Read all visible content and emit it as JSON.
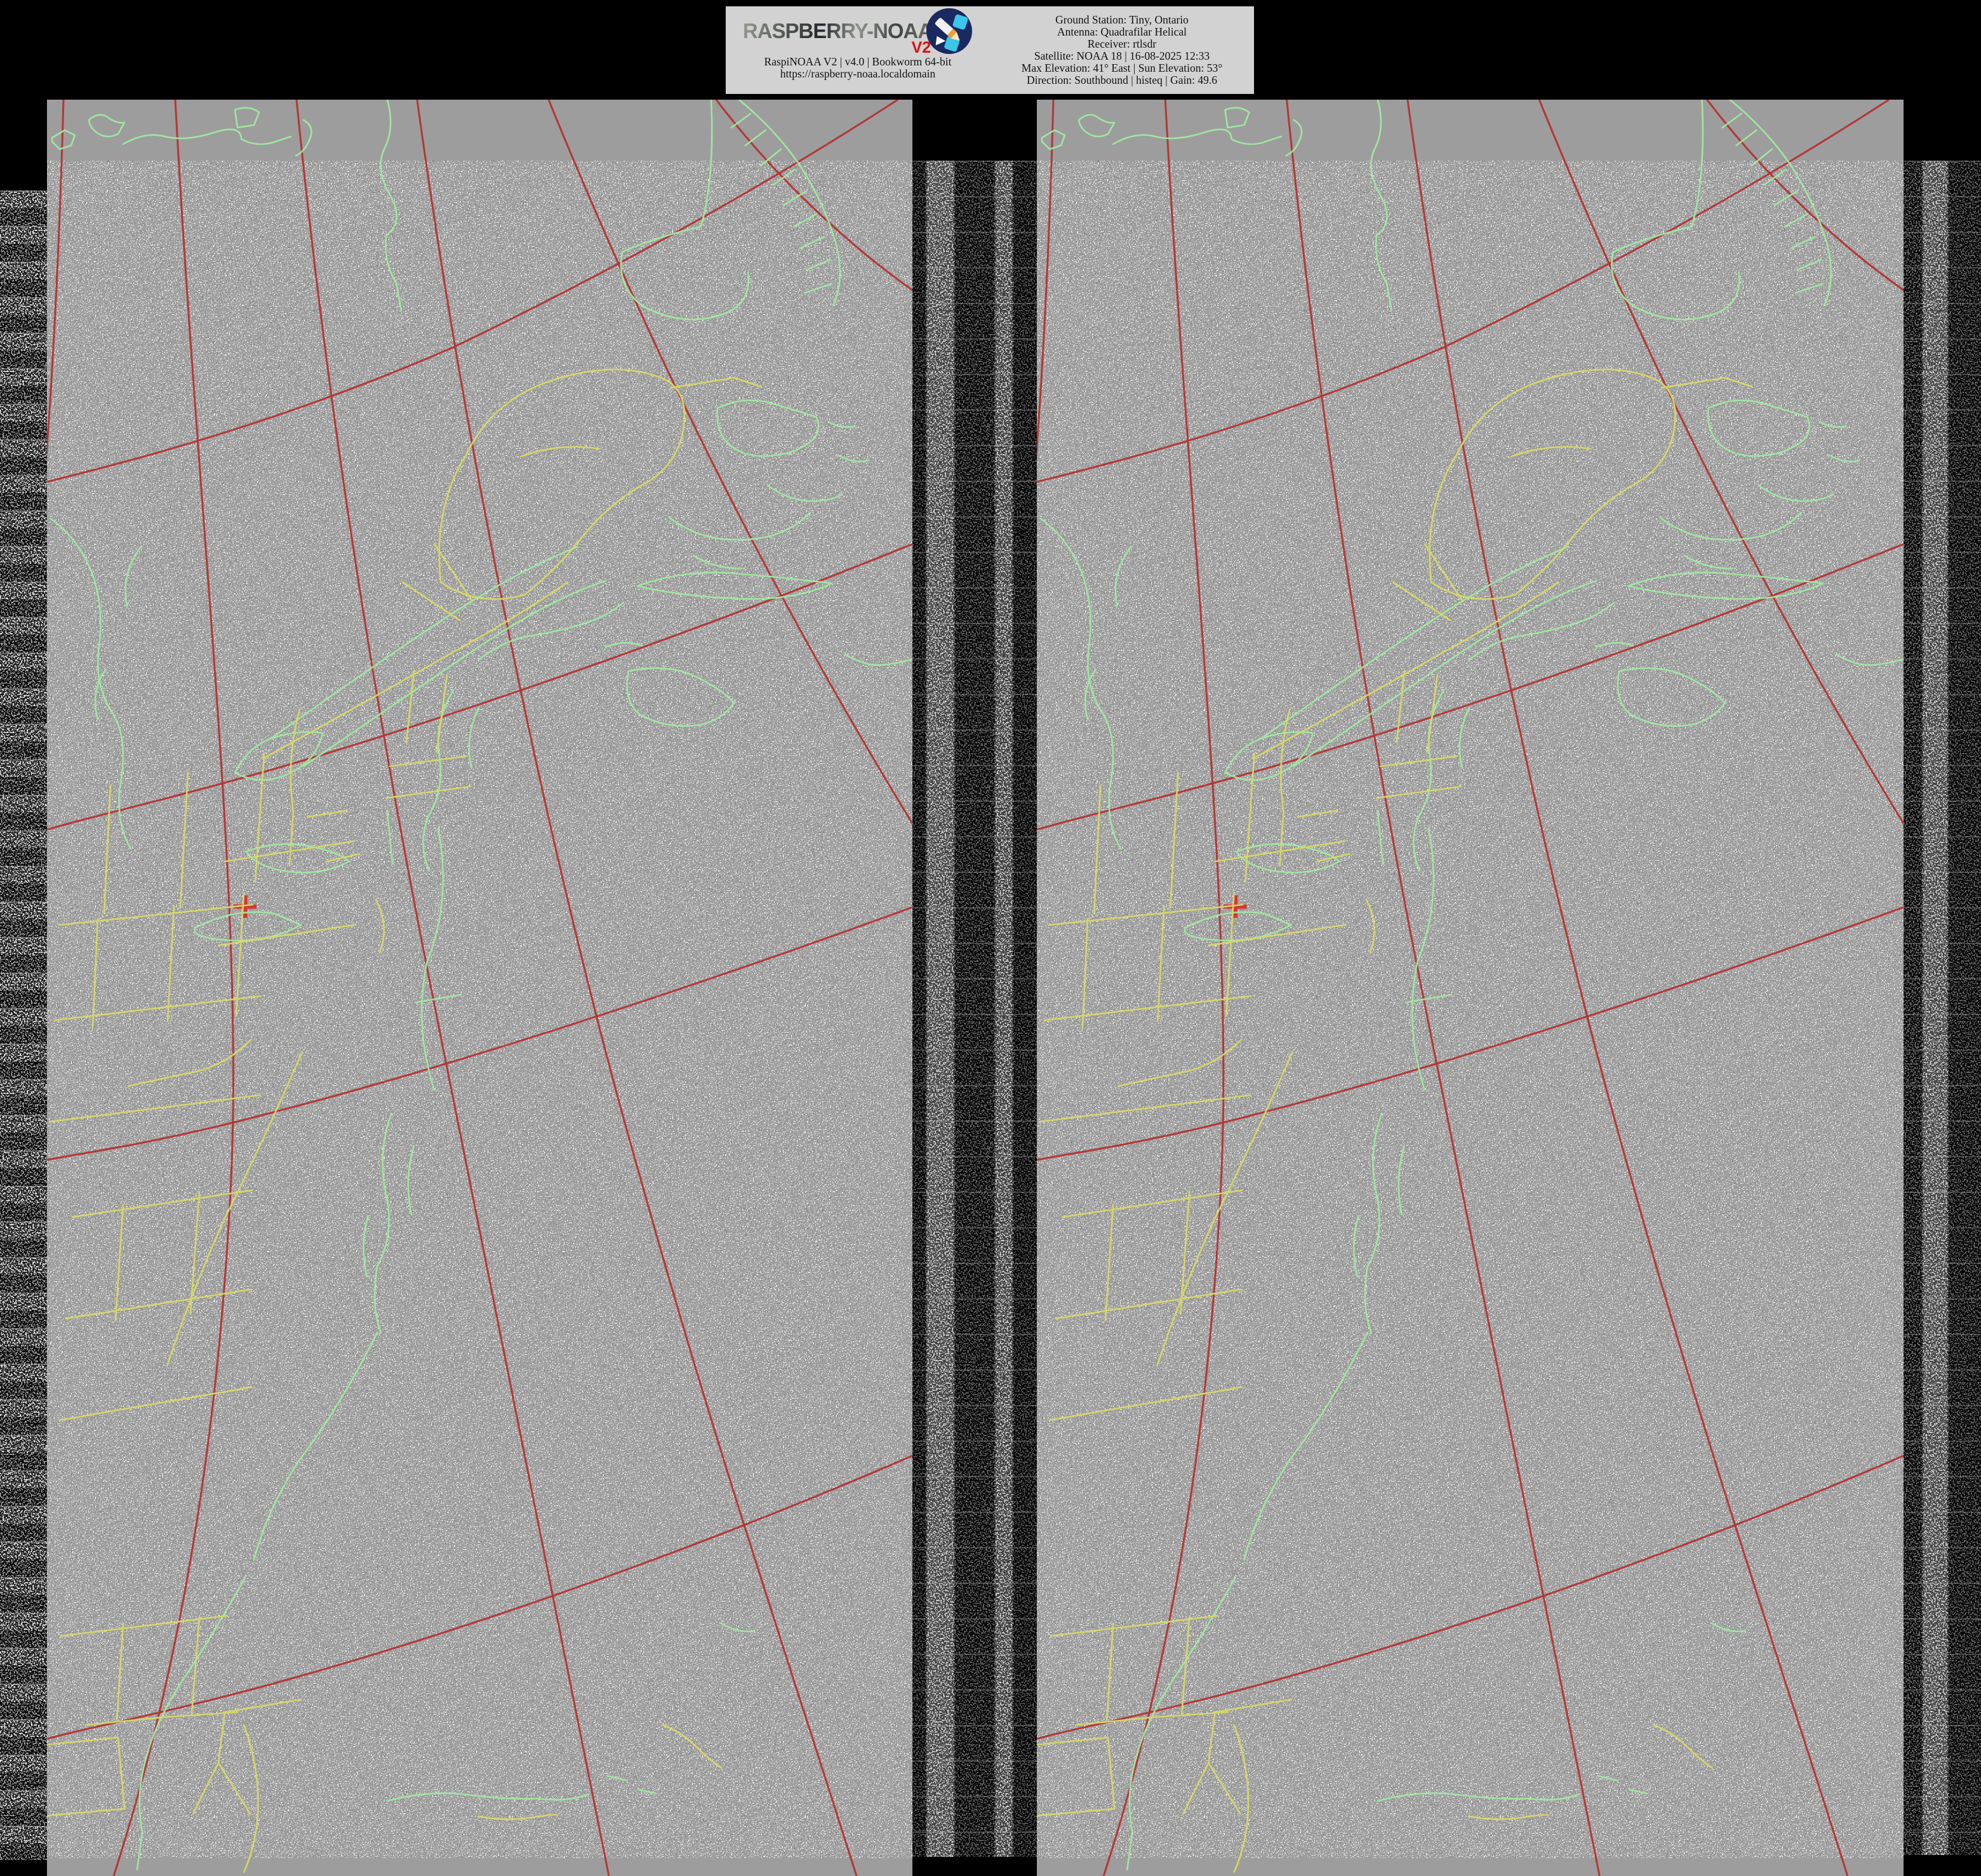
{
  "header": {
    "logo": {
      "title": "RASPBERRY-NOAA",
      "badge": "V2"
    },
    "left_lines": [
      "RaspiNOAA V2 | v4.0 | Bookworm 64-bit",
      "https://raspberry-noaa.localdomain"
    ],
    "right_lines": [
      "Ground Station: Tiny, Ontario",
      "Antenna: Quadrafilar Helical",
      "Receiver: rtlsdr",
      "Satellite: NOAA 18 | 16-08-2025 12:33",
      "Max Elevation: 41° East | Sun Elevation: 53°",
      "Direction: Southbound | histeq | Gain: 49.6"
    ]
  },
  "image": {
    "panel_names": [
      "satellite-image-channel-a",
      "satellite-image-channel-b"
    ],
    "overlay": {
      "coastline_color": "#a2e8a2",
      "border_color": "#d9d968",
      "graticule_color": "#b43232",
      "ground_station_marker": "+"
    },
    "colors": {
      "page_background": "#000000",
      "panel_gray": "#9d9d9d",
      "header_background": "#d2d2d2",
      "badge_red": "#dd1111",
      "emblem_navy": "#1a2960",
      "emblem_cyan": "#3bc6ea"
    }
  }
}
